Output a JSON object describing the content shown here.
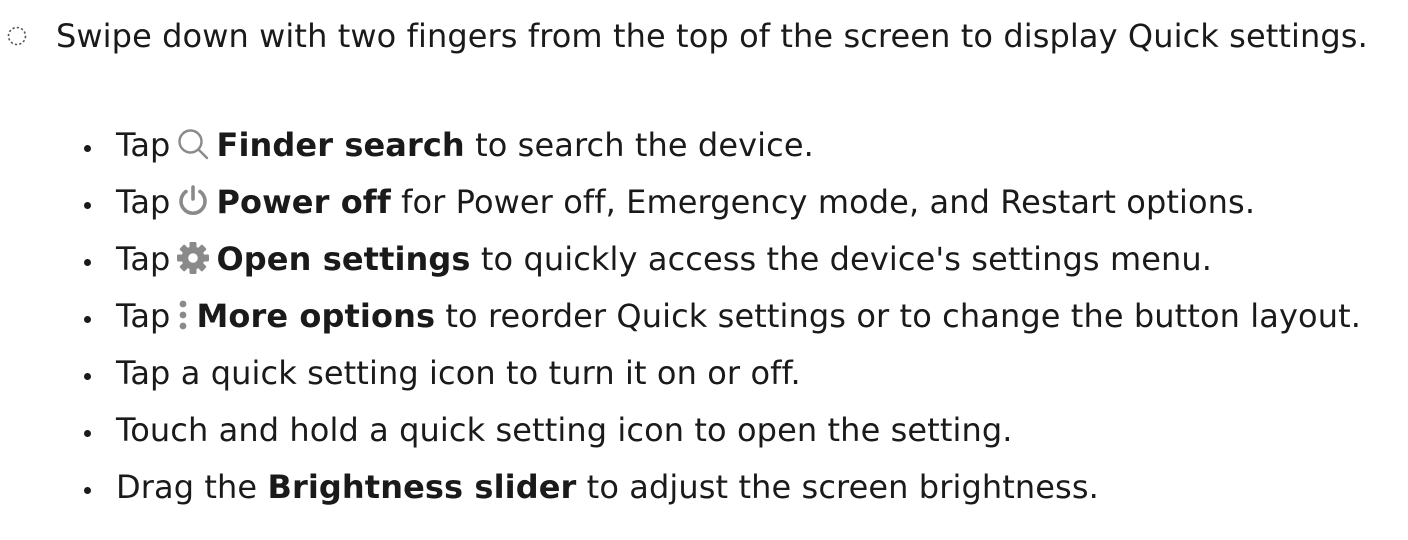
{
  "step": {
    "text": "Swipe down with two fingers from the top of the screen to display Quick settings."
  },
  "bullets": [
    {
      "prefix": "Tap",
      "icon": "search-icon",
      "bold": "Finder search",
      "suffix": " to search the device."
    },
    {
      "prefix": "Tap",
      "icon": "power-icon",
      "bold": "Power off",
      "suffix": " for Power off, Emergency mode, and Restart options."
    },
    {
      "prefix": "Tap",
      "icon": "gear-icon",
      "bold": "Open settings",
      "suffix": " to quickly access the device's settings menu."
    },
    {
      "prefix": "Tap",
      "icon": "more-options-icon",
      "bold": "More options",
      "suffix": " to reorder Quick settings or to change the button layout."
    },
    {
      "text": "Tap a quick setting icon to turn it on or off."
    },
    {
      "text": "Touch and hold a quick setting icon to open the setting."
    },
    {
      "prefix": "Drag the ",
      "bold": "Brightness slider",
      "suffix": " to adjust the screen brightness."
    }
  ],
  "colors": {
    "text": "#1a1a1a",
    "icon_gray": "#8a8a8a",
    "background": "#ffffff"
  }
}
